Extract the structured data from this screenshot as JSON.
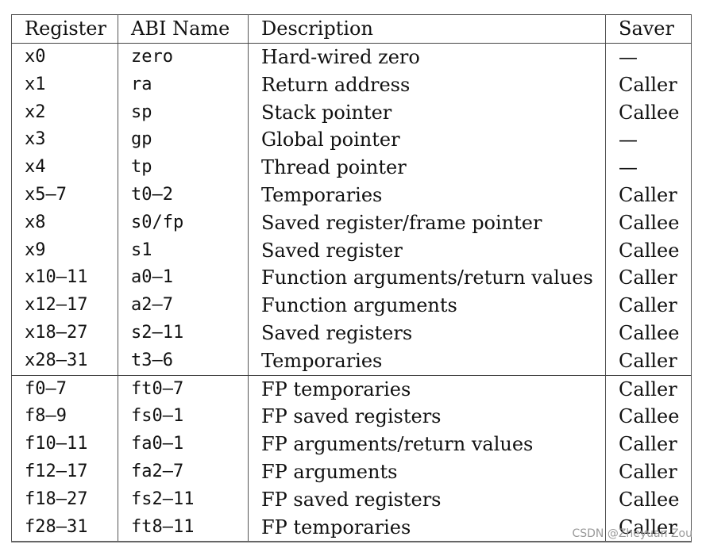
{
  "headers": [
    "Register",
    "ABI Name",
    "Description",
    "Saver"
  ],
  "integer_registers": [
    {
      "register": "x0",
      "abi": "zero",
      "description": "Hard-wired zero",
      "saver": "—"
    },
    {
      "register": "x1",
      "abi": "ra",
      "description": "Return address",
      "saver": "Caller"
    },
    {
      "register": "x2",
      "abi": "sp",
      "description": "Stack pointer",
      "saver": "Callee"
    },
    {
      "register": "x3",
      "abi": "gp",
      "description": "Global pointer",
      "saver": "—"
    },
    {
      "register": "x4",
      "abi": "tp",
      "description": "Thread pointer",
      "saver": "—"
    },
    {
      "register": "x5–7",
      "abi": "t0–2",
      "description": "Temporaries",
      "saver": "Caller"
    },
    {
      "register": "x8",
      "abi": "s0/fp",
      "description": "Saved register/frame pointer",
      "saver": "Callee"
    },
    {
      "register": "x9",
      "abi": "s1",
      "description": "Saved register",
      "saver": "Callee"
    },
    {
      "register": "x10–11",
      "abi": "a0–1",
      "description": "Function arguments/return values",
      "saver": "Caller"
    },
    {
      "register": "x12–17",
      "abi": "a2–7",
      "description": "Function arguments",
      "saver": "Caller"
    },
    {
      "register": "x18–27",
      "abi": "s2–11",
      "description": "Saved registers",
      "saver": "Callee"
    },
    {
      "register": "x28–31",
      "abi": "t3–6",
      "description": "Temporaries",
      "saver": "Caller"
    }
  ],
  "fp_registers": [
    {
      "register": "f0–7",
      "abi": "ft0–7",
      "description": "FP temporaries",
      "saver": "Caller"
    },
    {
      "register": "f8–9",
      "abi": "fs0–1",
      "description": "FP saved registers",
      "saver": "Callee"
    },
    {
      "register": "f10–11",
      "abi": "fa0–1",
      "description": "FP arguments/return values",
      "saver": "Caller"
    },
    {
      "register": "f12–17",
      "abi": "fa2–7",
      "description": "FP arguments",
      "saver": "Caller"
    },
    {
      "register": "f18–27",
      "abi": "fs2–11",
      "description": "FP saved registers",
      "saver": "Callee"
    },
    {
      "register": "f28–31",
      "abi": "ft8–11",
      "description": "FP temporaries",
      "saver": "Caller"
    }
  ],
  "watermark": "CSDN @Zheyuan Zou"
}
